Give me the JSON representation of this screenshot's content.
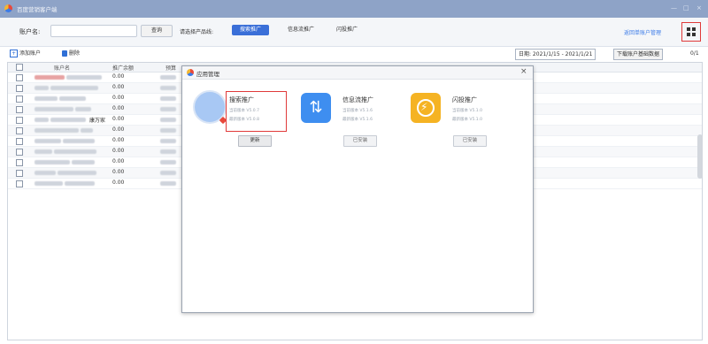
{
  "window": {
    "title": "百度营销客户端",
    "controls": [
      "—",
      "□",
      "×"
    ]
  },
  "toolbar": {
    "account_label": "账户名:",
    "query_button": "查询",
    "product_line_label": "请选择产品线:",
    "tabs": [
      {
        "label": "搜索推广",
        "active": true
      },
      {
        "label": "信息流推广",
        "active": false
      },
      {
        "label": "闪投推广",
        "active": false
      }
    ],
    "back_link": "返回单账户管理"
  },
  "actionbar": {
    "add_account": "添加账户",
    "delete": "删除",
    "date_range": "日期: 2021/1/15 - 2021/1/21",
    "download_button": "下载账户基础数据",
    "page_indicator": "0/1"
  },
  "table": {
    "headers": [
      "账户名",
      "推广余额",
      "预算"
    ],
    "rows": [
      {
        "amount": "0.00",
        "extra": ""
      },
      {
        "amount": "0.00",
        "extra": ""
      },
      {
        "amount": "0.00",
        "extra": ""
      },
      {
        "amount": "0.00",
        "extra": ""
      },
      {
        "amount": "0.00",
        "extra": "康万家"
      },
      {
        "amount": "0.00",
        "extra": ""
      },
      {
        "amount": "0.00",
        "extra": ""
      },
      {
        "amount": "0.00",
        "extra": ""
      },
      {
        "amount": "0.00",
        "extra": ""
      },
      {
        "amount": "0.00",
        "extra": ""
      },
      {
        "amount": "0.00",
        "extra": ""
      }
    ]
  },
  "dialog": {
    "title": "应用管理",
    "close": "×",
    "apps": [
      {
        "name": "搜索推广",
        "current_version": "当前版本 V5.0.7",
        "latest_version": "最新版本 V5.0.8",
        "button": "更新",
        "icon": "search-app-icon"
      },
      {
        "name": "信息流推广",
        "current_version": "当前版本 V5.1.6",
        "latest_version": "最新版本 V5.1.6",
        "button": "已安装",
        "icon": "feed-app-icon"
      },
      {
        "name": "闪投推广",
        "current_version": "当前版本 V5.1.0",
        "latest_version": "最新版本 V5.1.0",
        "button": "已安装",
        "icon": "flash-app-icon"
      }
    ]
  },
  "colors": {
    "titlebar": "#8ea3c7",
    "accent": "#3a6fd8",
    "highlight": "#e03a3a"
  }
}
